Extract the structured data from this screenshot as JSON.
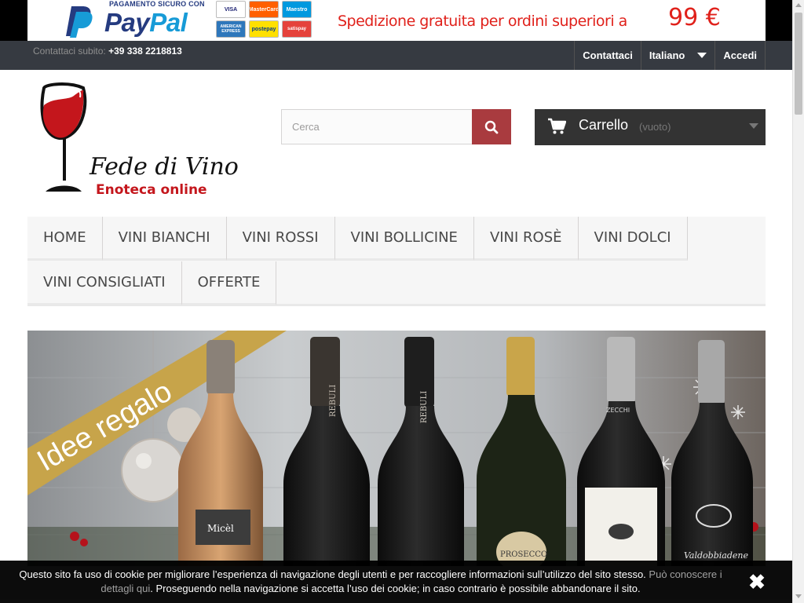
{
  "banner": {
    "paypal_caption": "PAGAMENTO SICURO CON",
    "paypal_word_pay": "Pay",
    "paypal_word_pal": "Pal",
    "cards": [
      "VISA",
      "MasterCard",
      "Maestro",
      "AMERICAN EXPRESS",
      "postepay",
      "satispay"
    ],
    "shipping_text": "Spedizione gratuita per ordini superiori a",
    "shipping_amount": "99 €"
  },
  "topbar": {
    "contact_label": "Contattaci subito:",
    "phone": "+39 338 2218813",
    "links": {
      "contact": "Contattaci",
      "language": "Italiano",
      "login": "Accedi"
    }
  },
  "header": {
    "logo_title": "Fede di Vino",
    "logo_subtitle": "Enoteca online",
    "search_placeholder": "Cerca",
    "cart_label": "Carrello",
    "cart_status": "(vuoto)"
  },
  "menu": {
    "row1": [
      "HOME",
      "VINI BIANCHI",
      "VINI ROSSI",
      "VINI BOLLICINE",
      "VINI ROSÈ",
      "VINI DOLCI"
    ],
    "row2": [
      "VINI CONSIGLIATI",
      "OFFERTE"
    ]
  },
  "hero": {
    "ribbon": "Idee regalo",
    "labels": [
      "Micèl",
      "REBULI",
      "REBULI",
      "PROSECCO",
      "ZECCHI",
      "Valdobbiadene"
    ]
  },
  "cookie": {
    "text": "Questo sito fa uso di cookie per migliorare l’esperienza di navigazione degli utenti e per raccogliere informazioni sull’utilizzo del sito stesso.",
    "link": "Può conoscere i dettagli qui",
    "text2": ". Proseguendo nella navigazione si accetta l’uso dei cookie; in caso contrario è possibile abbandonare il sito.",
    "close": "✖"
  },
  "colors": {
    "accent_red": "#a93b3f",
    "nav_dark": "#363a41",
    "cart_dark": "#333333",
    "shipping_red": "#e0211b",
    "paypal_blue": "#253b80",
    "paypal_light": "#179bd7"
  }
}
